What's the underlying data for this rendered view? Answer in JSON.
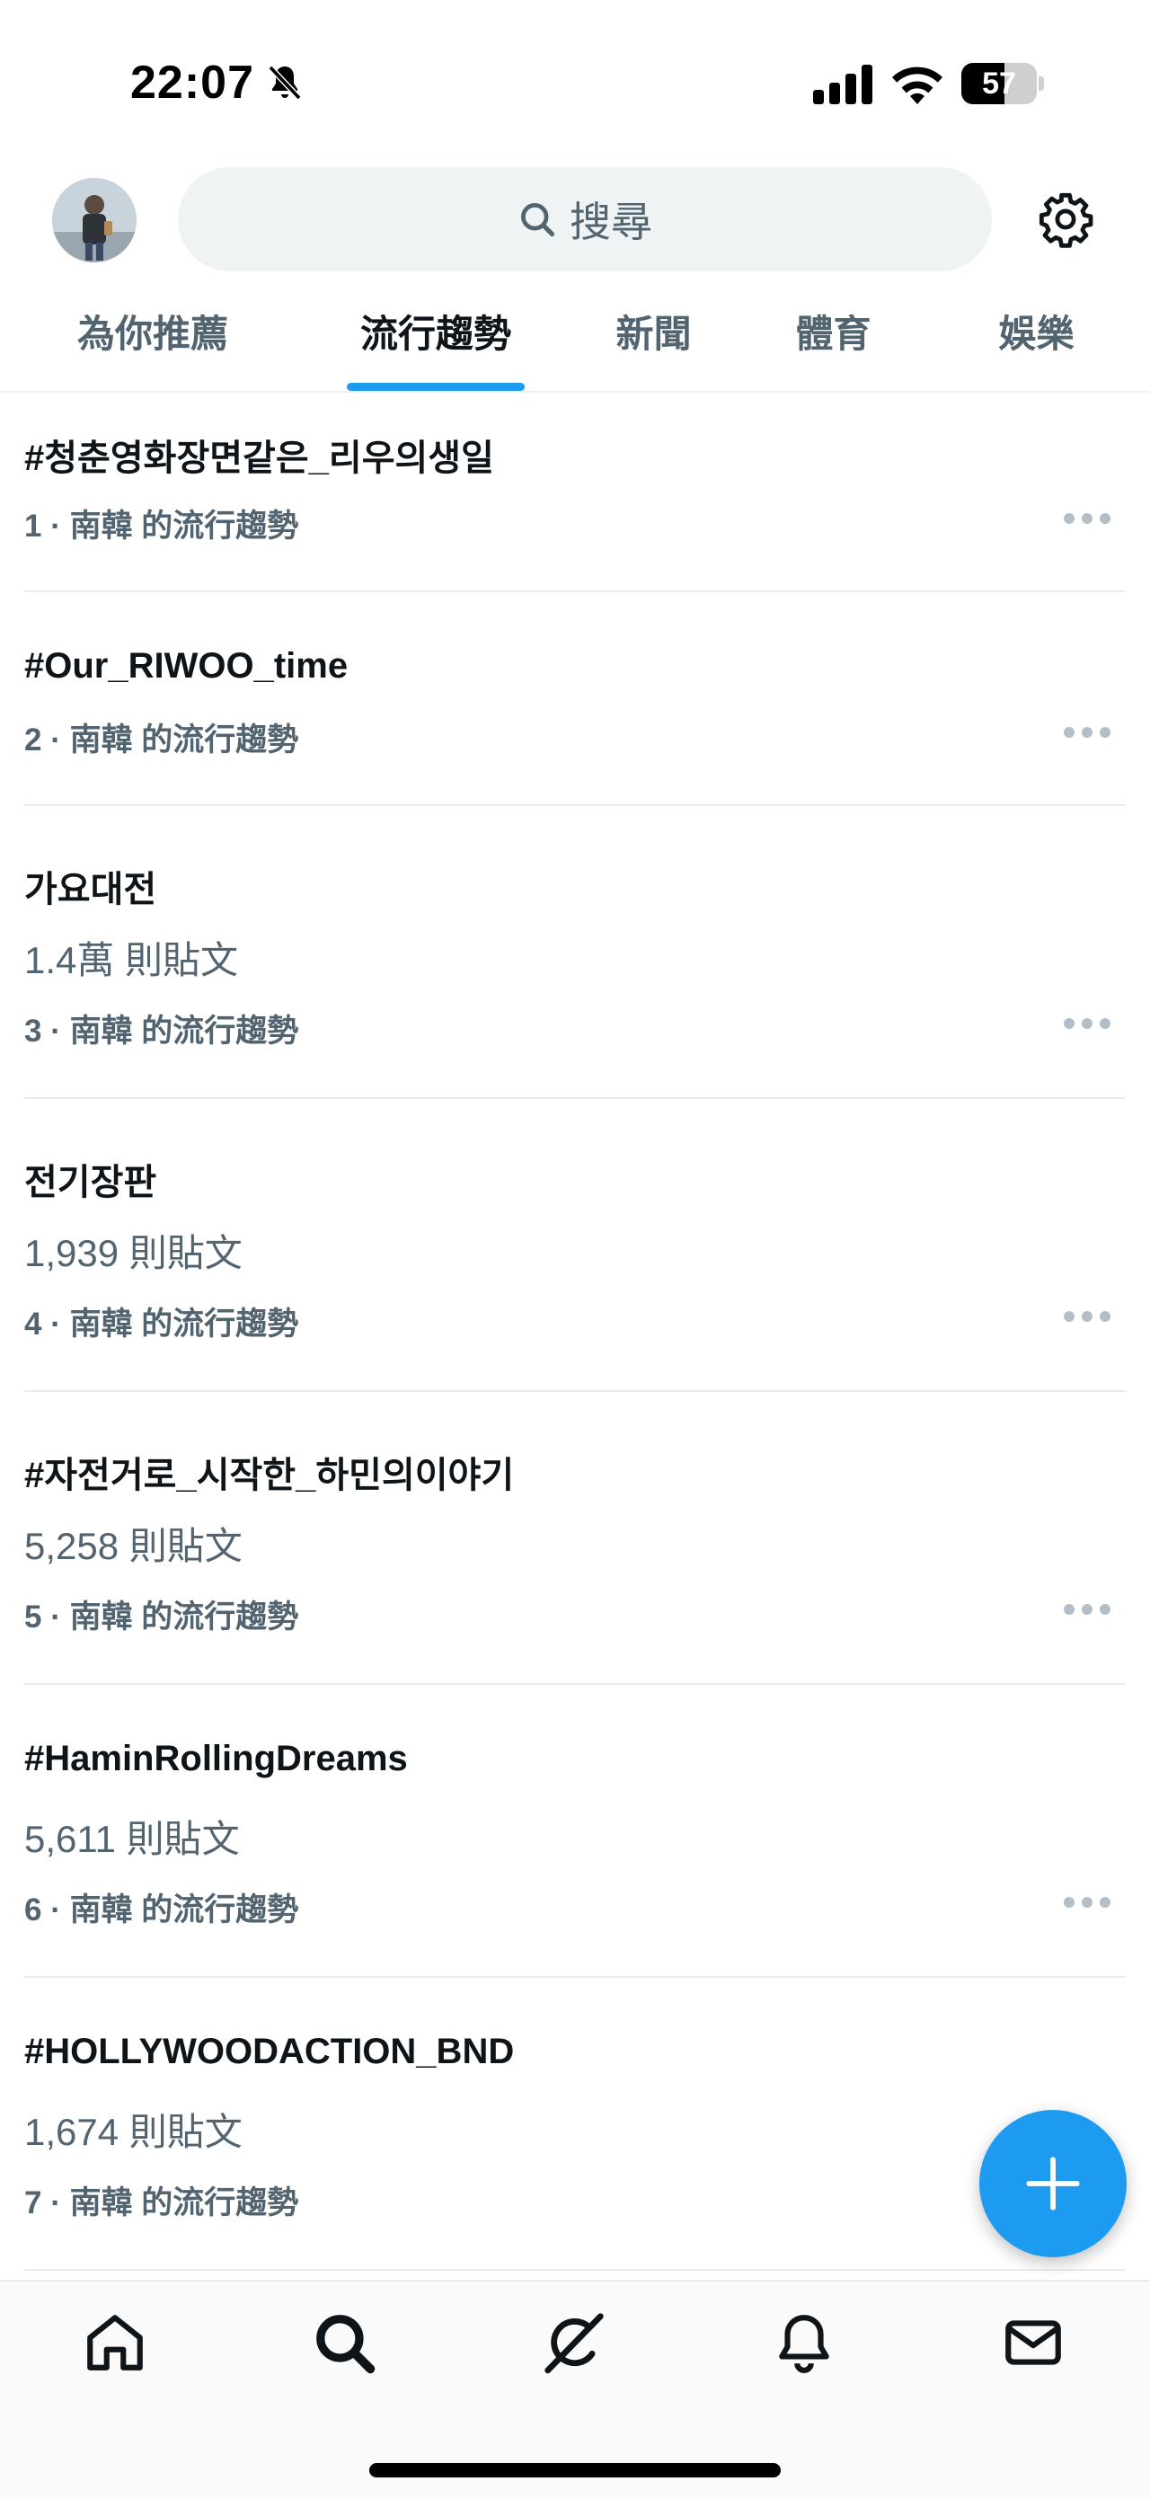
{
  "status_bar": {
    "time": "22:07",
    "battery": "57",
    "battery_level": 0.57
  },
  "header": {
    "search_placeholder": "搜尋"
  },
  "tabs": [
    {
      "label": "為你推薦",
      "active": false
    },
    {
      "label": "流行趨勢",
      "active": true
    },
    {
      "label": "新聞",
      "active": false
    },
    {
      "label": "體育",
      "active": false
    },
    {
      "label": "娛樂",
      "active": false
    }
  ],
  "trends": [
    {
      "title": "#청춘영화장면같은_리우의생일",
      "count": "",
      "meta": "1 · 南韓 的流行趨勢"
    },
    {
      "title": "#Our_RIWOO_time",
      "count": "",
      "meta": "2 · 南韓 的流行趨勢"
    },
    {
      "title": "가요대전",
      "count": "1.4萬 則貼文",
      "meta": "3 · 南韓 的流行趨勢"
    },
    {
      "title": "전기장판",
      "count": "1,939 則貼文",
      "meta": "4 · 南韓 的流行趨勢"
    },
    {
      "title": "#자전거로_시작한_하민의이야기",
      "count": "5,258 則貼文",
      "meta": "5 · 南韓 的流行趨勢"
    },
    {
      "title": "#HaminRollingDreams",
      "count": "5,611 則貼文",
      "meta": "6 · 南韓 的流行趨勢"
    },
    {
      "title": "#HOLLYWOODACTION_BND",
      "count": "1,674 則貼文",
      "meta": "7 · 南韓 的流行趨勢"
    }
  ],
  "colors": {
    "accent": "#1d9bf0",
    "primary_text": "#0f1419",
    "secondary_text": "#536471"
  },
  "icons": {
    "fab": "plus-icon",
    "nav": [
      "home-icon",
      "search-icon",
      "grok-icon",
      "notifications-icon",
      "messages-icon"
    ]
  }
}
